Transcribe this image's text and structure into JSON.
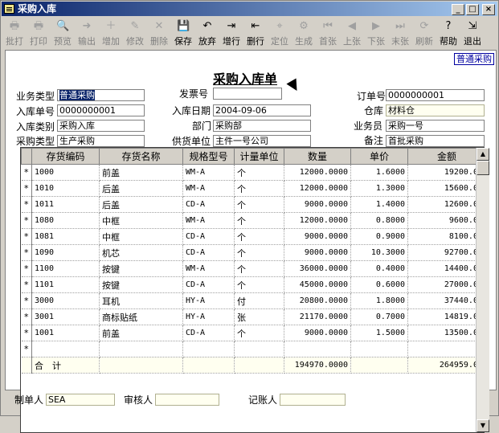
{
  "window": {
    "title": "采购入库"
  },
  "toolbar": [
    {
      "label": "批打",
      "icon": "batch-print-icon",
      "glyph": "🖶",
      "enabled": false
    },
    {
      "label": "打印",
      "icon": "print-icon",
      "glyph": "🖶",
      "enabled": false
    },
    {
      "label": "预览",
      "icon": "preview-icon",
      "glyph": "🔍",
      "enabled": false
    },
    {
      "label": "输出",
      "icon": "export-icon",
      "glyph": "➜",
      "enabled": false
    },
    {
      "label": "增加",
      "icon": "add-icon",
      "glyph": "＋",
      "enabled": false
    },
    {
      "label": "修改",
      "icon": "edit-icon",
      "glyph": "✎",
      "enabled": false
    },
    {
      "label": "删除",
      "icon": "delete-icon",
      "glyph": "✕",
      "enabled": false
    },
    {
      "label": "保存",
      "icon": "save-icon",
      "glyph": "💾",
      "enabled": true
    },
    {
      "label": "放弃",
      "icon": "discard-icon",
      "glyph": "↶",
      "enabled": true
    },
    {
      "label": "增行",
      "icon": "add-row-icon",
      "glyph": "⇥",
      "enabled": true
    },
    {
      "label": "删行",
      "icon": "delete-row-icon",
      "glyph": "⇤",
      "enabled": true
    },
    {
      "label": "定位",
      "icon": "locate-icon",
      "glyph": "⌖",
      "enabled": false
    },
    {
      "label": "生成",
      "icon": "generate-icon",
      "glyph": "⚙",
      "enabled": false
    },
    {
      "label": "首张",
      "icon": "first-icon",
      "glyph": "⏮",
      "enabled": false
    },
    {
      "label": "上张",
      "icon": "prev-icon",
      "glyph": "◀",
      "enabled": false
    },
    {
      "label": "下张",
      "icon": "next-icon",
      "glyph": "▶",
      "enabled": false
    },
    {
      "label": "末张",
      "icon": "last-icon",
      "glyph": "⏭",
      "enabled": false
    },
    {
      "label": "刷新",
      "icon": "refresh-icon",
      "glyph": "⟳",
      "enabled": false
    },
    {
      "label": "帮助",
      "icon": "help-icon",
      "glyph": "?",
      "enabled": true
    },
    {
      "label": "退出",
      "icon": "exit-icon",
      "glyph": "⇲",
      "enabled": true
    }
  ],
  "doc": {
    "tag": "普通采购",
    "title": "采购入库单",
    "fields": {
      "biz_type": {
        "label": "业务类型",
        "value": "普通采购"
      },
      "invoice_no": {
        "label": "发票号",
        "value": ""
      },
      "order_no": {
        "label": "订单号",
        "value": "0000000001"
      },
      "in_no": {
        "label": "入库单号",
        "value": "0000000001"
      },
      "in_date": {
        "label": "入库日期",
        "value": "2004-09-06"
      },
      "warehouse": {
        "label": "仓库",
        "value": "材料仓"
      },
      "in_category": {
        "label": "入库类别",
        "value": "采购入库"
      },
      "dept": {
        "label": "部门",
        "value": "采购部"
      },
      "clerk": {
        "label": "业务员",
        "value": "采购一号"
      },
      "purchase_type": {
        "label": "采购类型",
        "value": "生产采购"
      },
      "supplier": {
        "label": "供货单位",
        "value": "主件一号公司"
      },
      "remark": {
        "label": "备注",
        "value": "首批采购"
      }
    }
  },
  "grid": {
    "columns": [
      "存货编码",
      "存货名称",
      "规格型号",
      "计量单位",
      "数量",
      "单价",
      "金额"
    ],
    "rows": [
      {
        "code": "1000",
        "name": "前盖",
        "spec": "WM-A",
        "unit": "个",
        "qty": "12000.0000",
        "price": "1.6000",
        "amount": "19200.00"
      },
      {
        "code": "1010",
        "name": "后盖",
        "spec": "WM-A",
        "unit": "个",
        "qty": "12000.0000",
        "price": "1.3000",
        "amount": "15600.00"
      },
      {
        "code": "1011",
        "name": "后盖",
        "spec": "CD-A",
        "unit": "个",
        "qty": "9000.0000",
        "price": "1.4000",
        "amount": "12600.00"
      },
      {
        "code": "1080",
        "name": "中框",
        "spec": "WM-A",
        "unit": "个",
        "qty": "12000.0000",
        "price": "0.8000",
        "amount": "9600.00"
      },
      {
        "code": "1081",
        "name": "中框",
        "spec": "CD-A",
        "unit": "个",
        "qty": "9000.0000",
        "price": "0.9000",
        "amount": "8100.00"
      },
      {
        "code": "1090",
        "name": "机芯",
        "spec": "CD-A",
        "unit": "个",
        "qty": "9000.0000",
        "price": "10.3000",
        "amount": "92700.00"
      },
      {
        "code": "1100",
        "name": "按键",
        "spec": "WM-A",
        "unit": "个",
        "qty": "36000.0000",
        "price": "0.4000",
        "amount": "14400.00"
      },
      {
        "code": "1101",
        "name": "按键",
        "spec": "CD-A",
        "unit": "个",
        "qty": "45000.0000",
        "price": "0.6000",
        "amount": "27000.00"
      },
      {
        "code": "3000",
        "name": "耳机",
        "spec": "HY-A",
        "unit": "付",
        "qty": "20800.0000",
        "price": "1.8000",
        "amount": "37440.00"
      },
      {
        "code": "3001",
        "name": "商标贴纸",
        "spec": "HY-A",
        "unit": "张",
        "qty": "21170.0000",
        "price": "0.7000",
        "amount": "14819.00"
      },
      {
        "code": "1001",
        "name": "前盖",
        "spec": "CD-A",
        "unit": "个",
        "qty": "9000.0000",
        "price": "1.5000",
        "amount": "13500.00"
      }
    ],
    "row_marker": "*",
    "total": {
      "label": "合　计",
      "qty": "194970.0000",
      "amount": "264959.00"
    }
  },
  "footer": {
    "maker": {
      "label": "制单人",
      "value": "SEA"
    },
    "reviewer": {
      "label": "审核人",
      "value": ""
    },
    "bookkeeper": {
      "label": "记账人",
      "value": ""
    }
  }
}
